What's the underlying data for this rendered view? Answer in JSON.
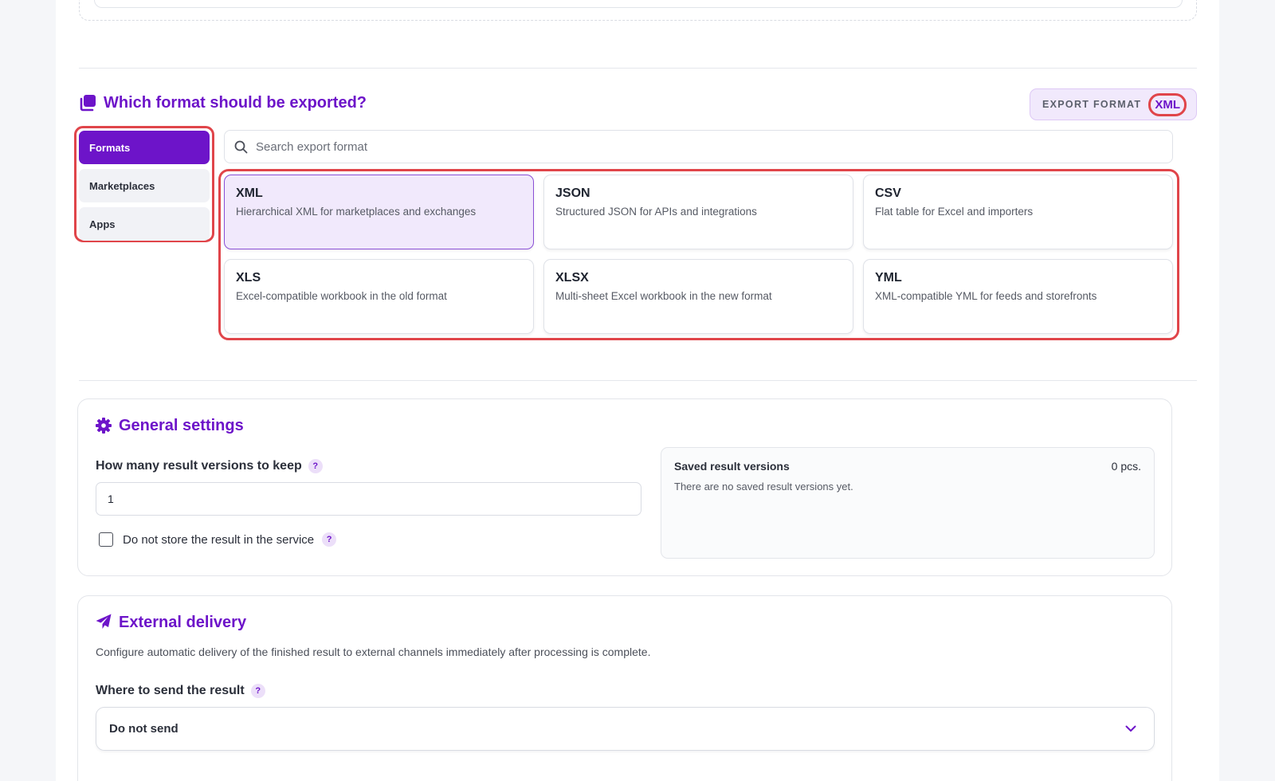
{
  "format_section": {
    "title": "Which format should be exported?",
    "export_format_label": "EXPORT FORMAT",
    "export_format_value": "XML"
  },
  "tabs": [
    {
      "label": "Formats",
      "active": true
    },
    {
      "label": "Marketplaces",
      "active": false
    },
    {
      "label": "Apps",
      "active": false
    }
  ],
  "search": {
    "placeholder": "Search export format",
    "value": ""
  },
  "formats": [
    {
      "name": "XML",
      "desc": "Hierarchical XML for marketplaces and exchanges",
      "selected": true
    },
    {
      "name": "JSON",
      "desc": "Structured JSON for APIs and integrations",
      "selected": false
    },
    {
      "name": "CSV",
      "desc": "Flat table for Excel and importers",
      "selected": false
    },
    {
      "name": "XLS",
      "desc": "Excel-compatible workbook in the old format",
      "selected": false
    },
    {
      "name": "XLSX",
      "desc": "Multi-sheet Excel workbook in the new format",
      "selected": false
    },
    {
      "name": "YML",
      "desc": "XML-compatible YML for feeds and storefronts",
      "selected": false
    }
  ],
  "general": {
    "title": "General settings",
    "versions_label": "How many result versions to keep",
    "versions_value": "1",
    "help_mark": "?",
    "no_store_label": "Do not store the result in the service",
    "no_store_checked": false,
    "saved_title": "Saved result versions",
    "saved_count": "0 pcs.",
    "saved_empty": "There are no saved result versions yet."
  },
  "delivery": {
    "title": "External delivery",
    "description": "Configure automatic delivery of the finished result to external channels immediately after processing is complete.",
    "where_label": "Where to send the result",
    "where_value": "Do not send"
  },
  "colors": {
    "accent": "#6d14c9",
    "accent_light": "#f1e9fc",
    "highlight": "#e0454a"
  },
  "icons": {
    "format": "copy-icon",
    "search": "search-icon",
    "general": "gear-icon",
    "delivery": "paper-plane-icon",
    "select": "chevron-down-icon"
  }
}
